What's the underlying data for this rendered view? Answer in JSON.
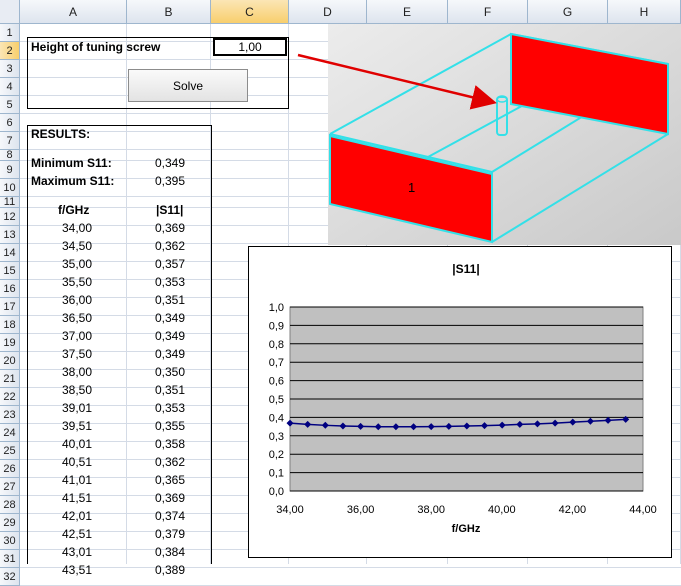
{
  "columns": [
    "A",
    "B",
    "C",
    "D",
    "E",
    "F",
    "G",
    "H"
  ],
  "rows": [
    "1",
    "2",
    "3",
    "4",
    "5",
    "6",
    "7",
    "8",
    "9",
    "10",
    "11",
    "12",
    "13",
    "14",
    "15",
    "16",
    "17",
    "18",
    "19",
    "20",
    "21",
    "22",
    "23",
    "24",
    "25",
    "26",
    "27",
    "28",
    "29",
    "30",
    "31",
    "32"
  ],
  "input": {
    "label": "Height of tuning screw",
    "value": "1,00"
  },
  "solve_button": "Solve",
  "results": {
    "header": "RESULTS:",
    "min_label": "Minimum S11:",
    "min_value": "0,349",
    "max_label": "Maximum S11:",
    "max_value": "0,395",
    "col_freq": "f/GHz",
    "col_s11": "|S11|",
    "freq": [
      "34,00",
      "34,50",
      "35,00",
      "35,50",
      "36,00",
      "36,50",
      "37,00",
      "37,50",
      "38,00",
      "38,50",
      "39,01",
      "39,51",
      "40,01",
      "40,51",
      "41,01",
      "41,51",
      "42,01",
      "42,51",
      "43,01",
      "43,51"
    ],
    "s11": [
      "0,369",
      "0,362",
      "0,357",
      "0,353",
      "0,351",
      "0,349",
      "0,349",
      "0,349",
      "0,350",
      "0,351",
      "0,353",
      "0,355",
      "0,358",
      "0,362",
      "0,365",
      "0,369",
      "0,374",
      "0,379",
      "0,384",
      "0,389"
    ]
  },
  "model": {
    "port_label": "1",
    "colors": {
      "wall": "#ff0000",
      "edge": "#33e0e8",
      "arrow": "#e00000"
    }
  },
  "chart_data": {
    "type": "line",
    "title": "|S11|",
    "xlabel": "f/GHz",
    "ylabel": "",
    "xlim": [
      34,
      44
    ],
    "ylim": [
      0,
      1
    ],
    "x_ticks": [
      "34,00",
      "36,00",
      "38,00",
      "40,00",
      "42,00",
      "44,00"
    ],
    "y_ticks": [
      "0,0",
      "0,1",
      "0,2",
      "0,3",
      "0,4",
      "0,5",
      "0,6",
      "0,7",
      "0,8",
      "0,9",
      "1,0"
    ],
    "x": [
      34.0,
      34.5,
      35.0,
      35.5,
      36.0,
      36.5,
      37.0,
      37.5,
      38.0,
      38.5,
      39.01,
      39.51,
      40.01,
      40.51,
      41.01,
      41.51,
      42.01,
      42.51,
      43.01,
      43.51
    ],
    "series": [
      {
        "values": [
          0.369,
          0.362,
          0.357,
          0.353,
          0.351,
          0.349,
          0.349,
          0.349,
          0.35,
          0.351,
          0.353,
          0.355,
          0.358,
          0.362,
          0.365,
          0.369,
          0.374,
          0.379,
          0.384,
          0.389
        ]
      }
    ],
    "grid": true,
    "colors": {
      "plot_bg": "#c0c0c0",
      "line": "#000080"
    }
  }
}
